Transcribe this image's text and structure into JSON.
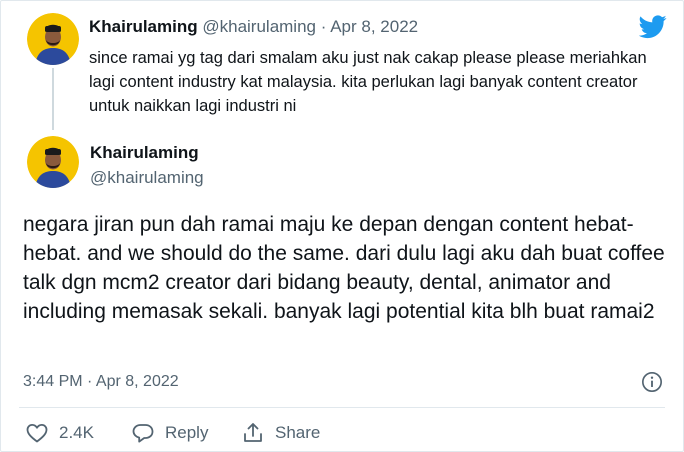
{
  "parent_tweet": {
    "author_name": "Khairulaming",
    "handle": "@khairulaming",
    "separator": "·",
    "date": "Apr 8, 2022",
    "text": "since ramai yg tag dari smalam aku just nak cakap please please meriahkan lagi content industry kat malaysia. kita perlukan lagi banyak content creator untuk naikkan lagi industri ni"
  },
  "main_tweet": {
    "author_name": "Khairulaming",
    "handle": "@khairulaming",
    "text": "negara jiran pun dah ramai maju ke depan dengan content hebat-hebat. and we should do the same. dari dulu lagi aku dah buat coffee talk dgn mcm2 creator dari bidang beauty, dental, animator and including memasak sekali. banyak lagi potential kita blh buat ramai2",
    "timestamp": "3:44 PM · Apr 8, 2022"
  },
  "actions": {
    "like_count": "2.4K",
    "reply_label": "Reply",
    "share_label": "Share"
  },
  "icons": {
    "brand": "twitter-bird-icon",
    "info": "info-icon",
    "like": "heart-icon",
    "reply": "reply-bubble-icon",
    "share": "share-icon"
  },
  "colors": {
    "brand_blue": "#1d9bf0",
    "secondary_text": "#536471",
    "primary_text": "#0f1419"
  }
}
